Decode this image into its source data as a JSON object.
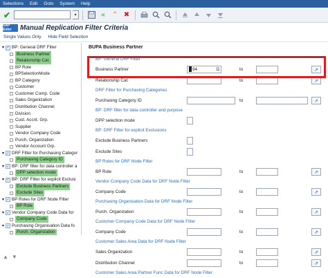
{
  "menubar": {
    "items": [
      "Selections",
      "Edit",
      "Goto",
      "System",
      "Help"
    ]
  },
  "titlebar": {
    "logo": "SAP Enter",
    "title": "Manual Replication Filter Criteria"
  },
  "app_toolbar": {
    "items": [
      "Single Values Only",
      "Hide Field Selection"
    ]
  },
  "tree": {
    "rows": [
      {
        "label": "BP: General DRF Filter",
        "kind": "folder",
        "highlight": false
      },
      {
        "label": "Business Partner",
        "kind": "leaf",
        "highlight": true
      },
      {
        "label": "Relationship Cat.",
        "kind": "leaf",
        "highlight": true
      },
      {
        "label": "BP Role",
        "kind": "leaf",
        "highlight": false
      },
      {
        "label": "BPSelectionMode",
        "kind": "leaf",
        "highlight": false
      },
      {
        "label": "BP Category",
        "kind": "leaf",
        "highlight": false
      },
      {
        "label": "Customer",
        "kind": "leaf",
        "highlight": false
      },
      {
        "label": "Customer Comp. Code",
        "kind": "leaf",
        "highlight": false
      },
      {
        "label": "Sales Organization",
        "kind": "leaf",
        "highlight": false
      },
      {
        "label": "Distribution Channel",
        "kind": "leaf",
        "highlight": false
      },
      {
        "label": "Division",
        "kind": "leaf",
        "highlight": false
      },
      {
        "label": "Cust. Accnt. Grp.",
        "kind": "leaf",
        "highlight": false
      },
      {
        "label": "Supplier",
        "kind": "leaf",
        "highlight": false
      },
      {
        "label": "Vendor Company Code",
        "kind": "leaf",
        "highlight": false
      },
      {
        "label": "Purch. Organization",
        "kind": "leaf",
        "highlight": false
      },
      {
        "label": "Vendor Account Grp.",
        "kind": "leaf",
        "highlight": false
      },
      {
        "label": "DRF Filter for Purchasing Categor",
        "kind": "folder",
        "highlight": false
      },
      {
        "label": "Purchasing Category ID",
        "kind": "leaf",
        "highlight": true
      },
      {
        "label": "BP: DRF filter for data controller a",
        "kind": "folder",
        "highlight": false
      },
      {
        "label": "DPP selection mode",
        "kind": "leaf",
        "highlight": true
      },
      {
        "label": "BP: DRF Filter for explicit Exclusi",
        "kind": "folder",
        "highlight": false
      },
      {
        "label": "Exclude Business Partners",
        "kind": "leaf",
        "highlight": true
      },
      {
        "label": "Exclude Sites",
        "kind": "leaf",
        "highlight": true
      },
      {
        "label": "BP Roles for DRF Node Filter",
        "kind": "folder",
        "highlight": false
      },
      {
        "label": "BP Role",
        "kind": "leaf",
        "highlight": true
      },
      {
        "label": "Vendor Company Code Data for",
        "kind": "folder",
        "highlight": false
      },
      {
        "label": "Company Code",
        "kind": "leaf",
        "highlight": true
      },
      {
        "label": "Purchasing Organisation Data fo",
        "kind": "folder",
        "highlight": false
      },
      {
        "label": "Purch. Organization",
        "kind": "leaf",
        "highlight": true
      }
    ]
  },
  "form": {
    "section_title": "BUPA Business Partner",
    "to_label": "to",
    "rows": [
      {
        "type": "group",
        "label": "BP: General DRF Filter"
      },
      {
        "type": "range",
        "label": "Business Partner",
        "value": "94"
      },
      {
        "type": "range",
        "label": "Relationship Cat.",
        "value": ""
      },
      {
        "type": "group",
        "label": "DRF Filter for Purchasing Categories"
      },
      {
        "type": "range_wide",
        "label": "Purchasing Category ID",
        "value": ""
      },
      {
        "type": "group",
        "label": "BP: DRF filter for data controller and purpose"
      },
      {
        "type": "check",
        "label": "DPP selection mode"
      },
      {
        "type": "group",
        "label": "BP: DRF Filter for explicit Exclusions"
      },
      {
        "type": "check",
        "label": "Exclude Business Partners"
      },
      {
        "type": "check",
        "label": "Exclude Sites"
      },
      {
        "type": "group",
        "label": "BP Roles for DRF Node Filter"
      },
      {
        "type": "range",
        "label": "BP Role",
        "value": ""
      },
      {
        "type": "group",
        "label": "Vendor Company Code Data for DRF Node Filter"
      },
      {
        "type": "range",
        "label": "Company Code",
        "value": ""
      },
      {
        "type": "group",
        "label": "Purchasing Organisation Data for DRF Node Filter"
      },
      {
        "type": "range",
        "label": "Purch. Organization",
        "value": ""
      },
      {
        "type": "group",
        "label": "Customer Company Code Data for DRF Node Filter"
      },
      {
        "type": "range",
        "label": "Company Code",
        "value": ""
      },
      {
        "type": "group",
        "label": "Customer Sales Area Data for DRF Node Filter"
      },
      {
        "type": "range",
        "label": "Sales Organization",
        "value": ""
      },
      {
        "type": "range",
        "label": "Distribution Channel",
        "value": ""
      },
      {
        "type": "group",
        "label": "Customer Sales Area Partner Func Data for DRF Node Filter"
      }
    ]
  },
  "colors": {
    "menubar": "#2b5f9e",
    "highlight": "#8fd08f",
    "group_text": "#2a6cc0",
    "red_box": "#e01b1b"
  }
}
